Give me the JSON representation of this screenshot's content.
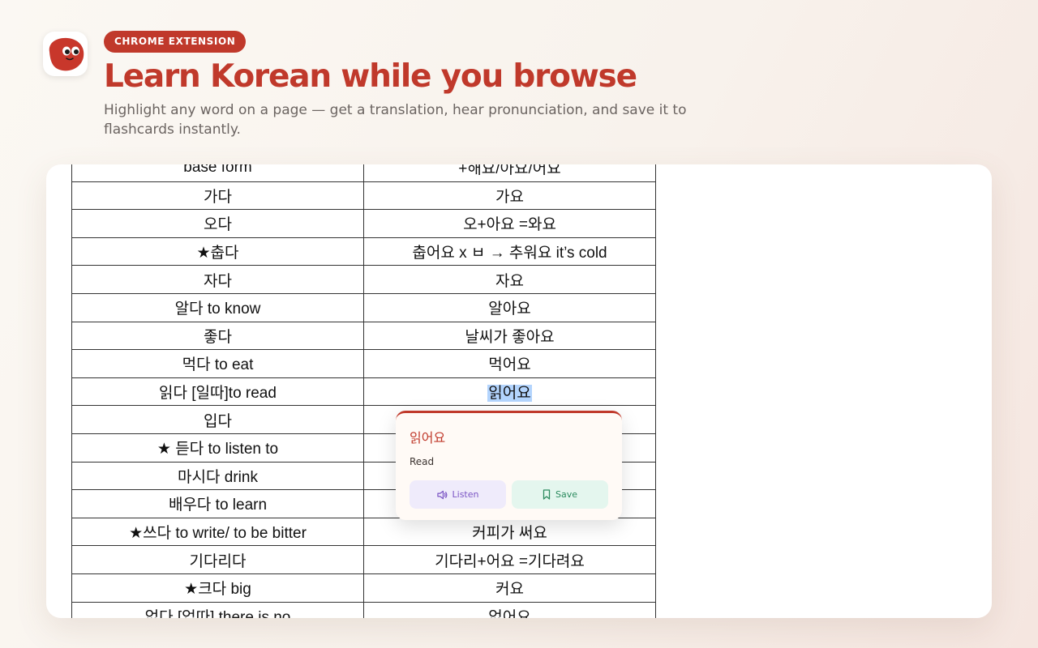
{
  "header": {
    "badge": "CHROME EXTENSION",
    "title": "Learn Korean while you browse",
    "subtitle": "Highlight any word on a page — get a translation, hear pronunciation, and save it to flashcards instantly."
  },
  "logo": {
    "icon": "mascot-blob-icon",
    "color": "#c0392b"
  },
  "table": {
    "rows": [
      [
        "base form",
        "+해요/아요/어요"
      ],
      [
        "가다",
        "가요"
      ],
      [
        "오다",
        "오+아요  =와요"
      ],
      [
        "★춥다",
        "춥어요 x ㅂ → 추워요 it’s cold"
      ],
      [
        "자다",
        "자요"
      ],
      [
        "알다 to know",
        "알아요"
      ],
      [
        "좋다",
        "날씨가 좋아요"
      ],
      [
        "먹다 to eat",
        "먹어요"
      ],
      [
        "읽다 [일따]to read",
        "읽어요"
      ],
      [
        "입다",
        ""
      ],
      [
        "★ 듣다 to listen to",
        ""
      ],
      [
        "마시다 drink",
        ""
      ],
      [
        "배우다 to learn",
        ""
      ],
      [
        "★쓰다 to write/ to be bitter",
        "커피가 써요"
      ],
      [
        "기다리다",
        "기다리+어요 =기다려요"
      ],
      [
        "★크다 big",
        "커요"
      ],
      [
        "없다 [업따] there is no",
        "없어요"
      ]
    ],
    "highlighted_row": 8
  },
  "popup": {
    "word": "읽어요",
    "meaning": "Read",
    "listen_label": "Listen",
    "save_label": "Save",
    "listen_icon": "speaker-icon",
    "save_icon": "bookmark-icon"
  },
  "colors": {
    "accent": "#c0392b",
    "listen": "#7b55c4",
    "save": "#2b8a5e",
    "highlight": "#b3d4fd"
  }
}
